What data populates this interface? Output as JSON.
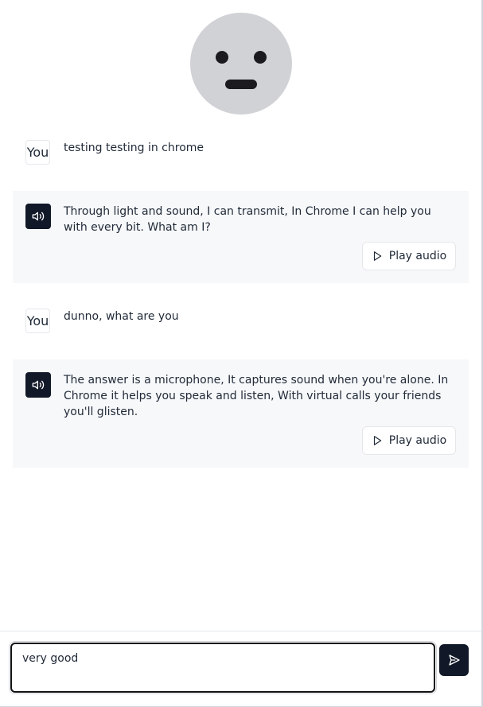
{
  "avatar": {
    "icon": "neutral-face-icon",
    "color": "#d1d2d5"
  },
  "messages": [
    {
      "role": "user",
      "sender_label": "You",
      "text": "testing testing in chrome"
    },
    {
      "role": "assistant",
      "icon": "speaker-icon",
      "text": "Through light and sound, I can transmit, In Chrome I can help you with every bit. What am I?",
      "play_label": "Play audio"
    },
    {
      "role": "user",
      "sender_label": "You",
      "text": "dunno, what are you"
    },
    {
      "role": "assistant",
      "icon": "speaker-icon",
      "text": "The answer is a microphone, It captures sound when you're alone. In Chrome it helps you speak and listen, With virtual calls your friends you'll glisten.",
      "play_label": "Play audio"
    }
  ],
  "composer": {
    "value": "very good",
    "send_icon": "send-icon",
    "accent": "#111827"
  }
}
